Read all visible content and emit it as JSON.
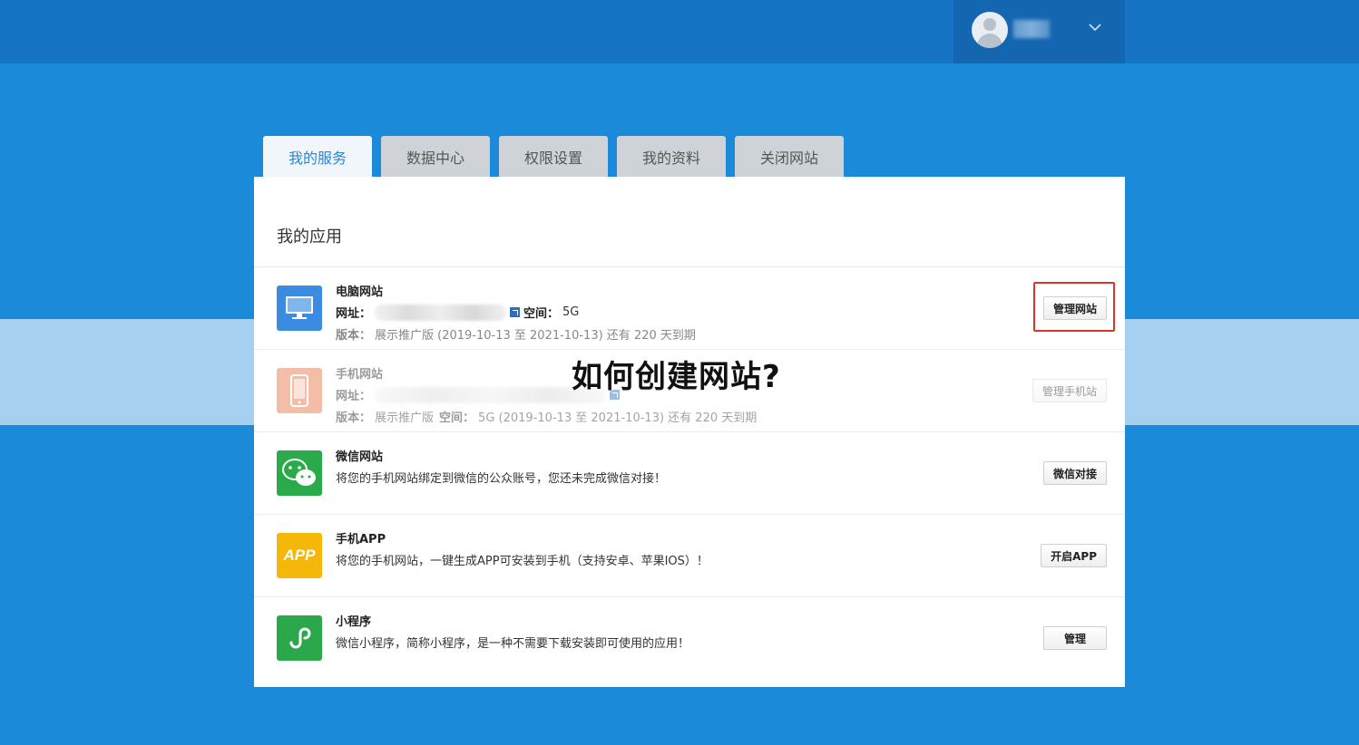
{
  "tabs": [
    {
      "label": "我的服务",
      "active": true
    },
    {
      "label": "数据中心",
      "active": false
    },
    {
      "label": "权限设置",
      "active": false
    },
    {
      "label": "我的资料",
      "active": false
    },
    {
      "label": "关闭网站",
      "active": false
    }
  ],
  "panel_title": "我的应用",
  "overlay_title": "如何创建网站?",
  "apps": {
    "pc": {
      "title": "电脑网站",
      "url_label": "网址：",
      "space_label": "空间：",
      "space_value": "5G",
      "version_label": "版本：",
      "version_value": "展示推广版 (2019-10-13 至 2021-10-13) 还有 220 天到期",
      "button": "管理网站"
    },
    "mobile": {
      "title": "手机网站",
      "url_label": "网址：",
      "version_label": "版本：",
      "version_value": "展示推广版",
      "space_label": "空间：",
      "space_value": "5G (2019-10-13 至 2021-10-13) 还有 220 天到期",
      "button": "管理手机站"
    },
    "wechat": {
      "title": "微信网站",
      "desc": "将您的手机网站绑定到微信的公众账号，您还未完成微信对接！",
      "button": "微信对接"
    },
    "app": {
      "title": "手机APP",
      "icon_text": "APP",
      "desc": "将您的手机网站，一键生成APP可安装到手机（支持安卓、苹果IOS）！",
      "button": "开启APP"
    },
    "mini": {
      "title": "小程序",
      "desc": "微信小程序，简称小程序，是一种不需要下载安装即可使用的应用！",
      "button": "管理"
    }
  },
  "colors": {
    "background": "#1a8ad9",
    "topbar": "#1773c3",
    "tab_active_text": "#2c85d8",
    "pc_icon": "#3b8be0",
    "mobile_icon": "#f0a88a",
    "wechat_icon": "#2aaa4a",
    "app_icon": "#f5b70a",
    "mini_icon": "#2aa84a",
    "highlight": "#d9362b"
  },
  "icons": {
    "avatar": "user-avatar-icon",
    "dropdown": "chevron-down-icon",
    "pc": "monitor-icon",
    "mobile": "phone-icon",
    "wechat": "wechat-icon",
    "app": "app-icon",
    "mini": "mini-program-icon",
    "link": "external-link-icon"
  }
}
